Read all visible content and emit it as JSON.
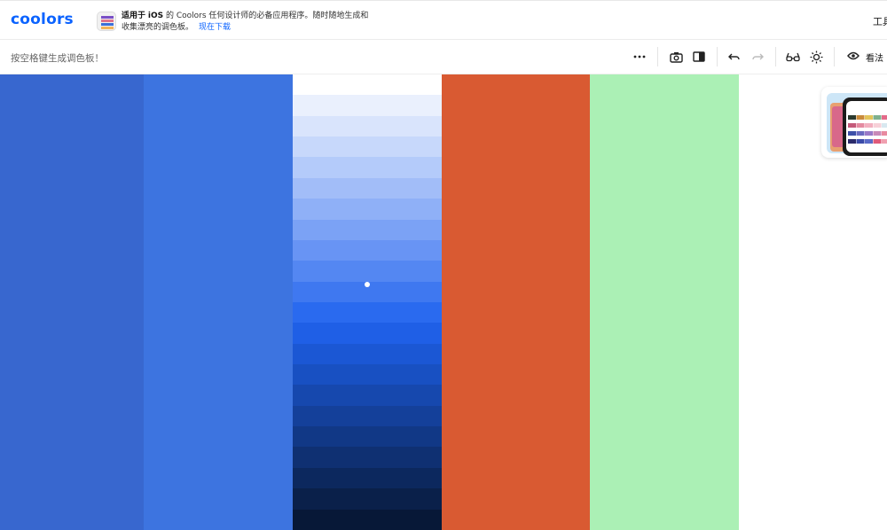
{
  "header": {
    "logo": "coolors",
    "promo_line1_prefix": "适用于",
    "promo_platform": "iOS",
    "promo_line1_suffix": "的 Coolors 任何设计师的必备应用程序。随时随地生成和",
    "promo_line2": "收集漂亮的调色板。",
    "promo_download": "现在下载",
    "tools_label": "工具"
  },
  "toolbar": {
    "hint": "按空格键生成调色板！",
    "view_label": "看法",
    "icons": [
      "more-icon",
      "camera-icon",
      "sidebar-icon",
      "undo-icon",
      "redo-icon",
      "glasses-icon",
      "sun-icon",
      "eye-icon"
    ]
  },
  "palette": {
    "colors": [
      "#3867cf",
      "#3d74e0",
      null,
      "#d95a32",
      "#abf0b5"
    ],
    "shades": [
      "#ffffff",
      "#eaf0fd",
      "#d9e4fc",
      "#c7d8fb",
      "#b4cbfa",
      "#a2bdf8",
      "#8fb0f7",
      "#7ba2f5",
      "#6894f4",
      "#5487f2",
      "#3f78f0",
      "#2a6aef",
      "#1f5fe6",
      "#1b57d4",
      "#1850c2",
      "#1648ae",
      "#14409a",
      "#113886",
      "#0f3072",
      "#0c285e",
      "#0a204a",
      "#071837"
    ]
  },
  "ad": {
    "swatches": [
      [
        "#2b3a2e",
        "#c98a3a",
        "#e3c45a",
        "#7fb08e",
        "#e46a8a"
      ],
      [
        "#c45a7a",
        "#e48aa0",
        "#f2b0c0",
        "#f7d0d8",
        "#d8e8f0"
      ],
      [
        "#3d4fa8",
        "#6a6ac0",
        "#9a7ac8",
        "#c88ab8",
        "#e88aa0"
      ],
      [
        "#2a2a6a",
        "#3a4aa8",
        "#5a6ac8",
        "#e05a7a",
        "#f0a0b0"
      ]
    ]
  }
}
